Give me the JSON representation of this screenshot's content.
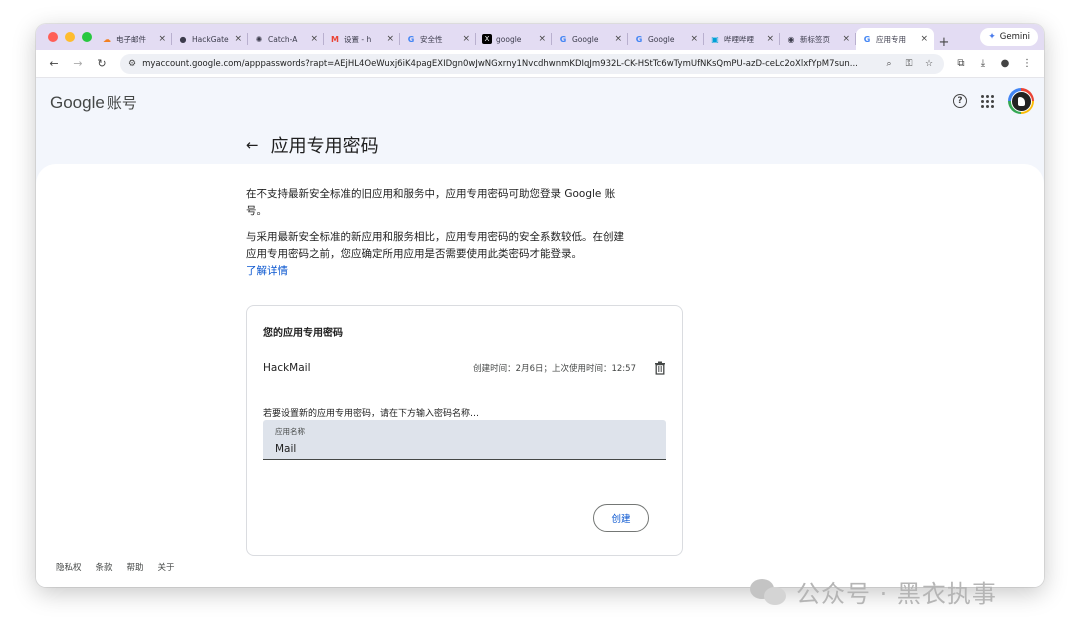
{
  "browser": {
    "tabs": [
      {
        "title": "电子邮件",
        "icon": "cloud-icon",
        "active": false
      },
      {
        "title": "HackGate",
        "icon": "github-icon",
        "active": false
      },
      {
        "title": "Catch-A",
        "icon": "openai-icon",
        "active": false
      },
      {
        "title": "设置 - h",
        "icon": "gmail-icon",
        "active": false
      },
      {
        "title": "安全性",
        "icon": "google-icon",
        "active": false
      },
      {
        "title": "google",
        "icon": "x-icon",
        "active": false
      },
      {
        "title": "Google",
        "icon": "google-icon",
        "active": false
      },
      {
        "title": "Google",
        "icon": "google-icon",
        "active": false
      },
      {
        "title": "哔哩哔哩",
        "icon": "bilibili-icon",
        "active": false
      },
      {
        "title": "新标签页",
        "icon": "chrome-icon",
        "active": false
      },
      {
        "title": "应用专用",
        "icon": "google-icon",
        "active": true
      }
    ],
    "tab_close_glyph": "×",
    "new_tab_glyph": "+",
    "gemini_label": "Gemini",
    "url": "myaccount.google.com/apppasswords?rapt=AEjHL4OeWuxj6iK4pagEXIDgn0wJwNGxrny1NvcdhwnmKDIqJm932L-CK-HStTc6wTymUfNKsQmPU-azD-ceLc2oXlxfYpM7sun..."
  },
  "header": {
    "logo_text": "Google",
    "product_text": "账号"
  },
  "page": {
    "title": "应用专用密码",
    "intro_1": "在不支持最新安全标准的旧应用和服务中，应用专用密码可助您登录 Google 账号。",
    "intro_2": "与采用最新安全标准的新应用和服务相比，应用专用密码的安全系数较低。在创建应用专用密码之前，您应确定所用应用是否需要使用此类密码才能登录。",
    "learn_more": "了解详情"
  },
  "passwords_card": {
    "title": "您的应用专用密码",
    "entries": [
      {
        "name": "HackMail",
        "meta": "创建时间：2月6日；上次使用时间：12:57"
      }
    ],
    "hint": "若要设置新的应用专用密码，请在下方输入密码名称…",
    "field_label": "应用名称",
    "field_value": "Mail",
    "create_label": "创建"
  },
  "footer": {
    "links": [
      "隐私权",
      "条款",
      "帮助",
      "关于"
    ]
  },
  "watermark": {
    "text": "公众号 · 黑衣执事"
  },
  "colors": {
    "accent": "#0b57d0",
    "tabstrip": "#e3dcf3",
    "page_bg": "#f3f6fc"
  }
}
